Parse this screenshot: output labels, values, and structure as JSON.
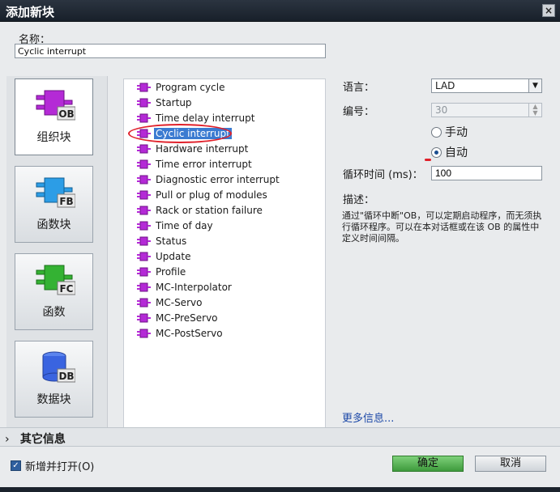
{
  "window": {
    "title": "添加新块",
    "close_label": "×"
  },
  "name": {
    "label": "名称：",
    "value": "Cyclic interrupt"
  },
  "categories": [
    {
      "label": "组织块",
      "tag": "OB",
      "color": "#b42ad6"
    },
    {
      "label": "函数块",
      "tag": "FB",
      "color": "#2c9de6"
    },
    {
      "label": "函数",
      "tag": "FC",
      "color": "#34b233"
    },
    {
      "label": "数据块",
      "tag": "DB",
      "color": "#3a64e0"
    }
  ],
  "blocks": [
    "Program cycle",
    "Startup",
    "Time delay interrupt",
    "Cyclic interrupt",
    "Hardware interrupt",
    "Time error interrupt",
    "Diagnostic error interrupt",
    "Pull or plug of modules",
    "Rack or station failure",
    "Time of day",
    "Status",
    "Update",
    "Profile",
    "MC-Interpolator",
    "MC-Servo",
    "MC-PreServo",
    "MC-PostServo"
  ],
  "selected_block": "Cyclic interrupt",
  "props": {
    "language_label": "语言：",
    "language_value": "LAD",
    "number_label": "编号：",
    "number_value": "30",
    "radio_manual": "手动",
    "radio_auto": "自动",
    "cycle_label": "循环时间 (ms)：",
    "cycle_value": "100",
    "desc_label": "描述：",
    "desc_text": "通过\"循环中断\"OB，可以定期启动程序，而无须执行循环程序。可以在本对话框或在该 OB 的属性中定义时间间隔。",
    "more_info": "更多信息..."
  },
  "footer": {
    "other_info": "其它信息",
    "checkbox_label": "新增并打开(O)",
    "ok_label": "确定",
    "cancel_label": "取消"
  }
}
